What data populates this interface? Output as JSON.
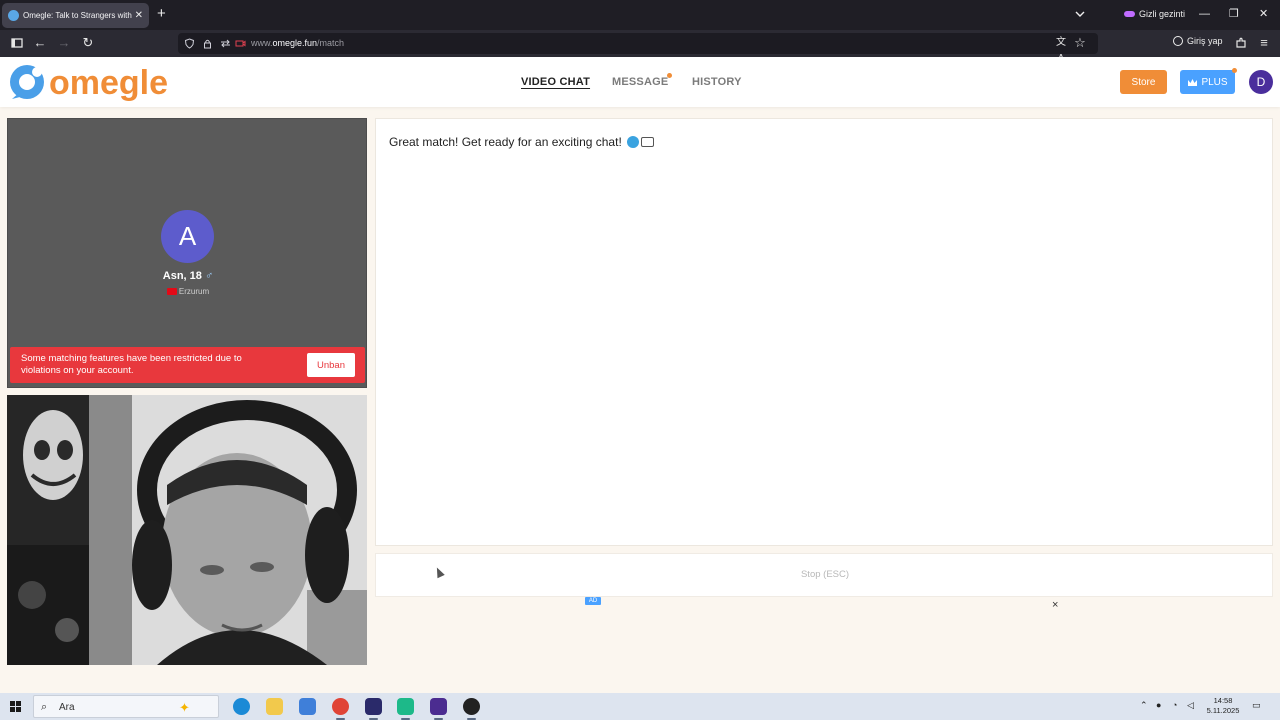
{
  "browser": {
    "tab_title": "Omegle: Talk to Strangers with",
    "tab_close": "✕",
    "new_tab": "+",
    "private_label": "Gizli gezinti",
    "url_prefix": "www.",
    "url_domain": "omegle.fun",
    "url_path": "/match",
    "signin_label": "Giriş yap",
    "window_controls": [
      "—",
      "❐",
      "✕"
    ]
  },
  "site": {
    "logo_text": "omegle",
    "nav": [
      {
        "label": "VIDEO CHAT",
        "active": true
      },
      {
        "label": "MESSAGE",
        "active": false,
        "badge": true
      },
      {
        "label": "HISTORY",
        "active": false
      }
    ],
    "store_label": "Store",
    "plus_label": "PLUS",
    "user_initial": "D",
    "colors": {
      "brand_orange": "#f08d37",
      "brand_blue": "#4aa1ff",
      "alert_red": "#e8383d",
      "avatar_purple": "#5d5ccc"
    }
  },
  "stranger": {
    "initial": "A",
    "name_age": "Asn, 18",
    "gender_symbol": "♂",
    "location": "Erzurum",
    "restriction_message": "Some matching features have been restricted due to violations on your account.",
    "unban_label": "Unban"
  },
  "chat": {
    "message": "Great match! Get ready for an exciting chat!",
    "stop_label": "Stop (ESC)",
    "ad_badge": "AD",
    "ad_close": "×"
  },
  "taskbar": {
    "search_placeholder": "Ara",
    "time": "14:58",
    "date": "5.11.2025"
  }
}
